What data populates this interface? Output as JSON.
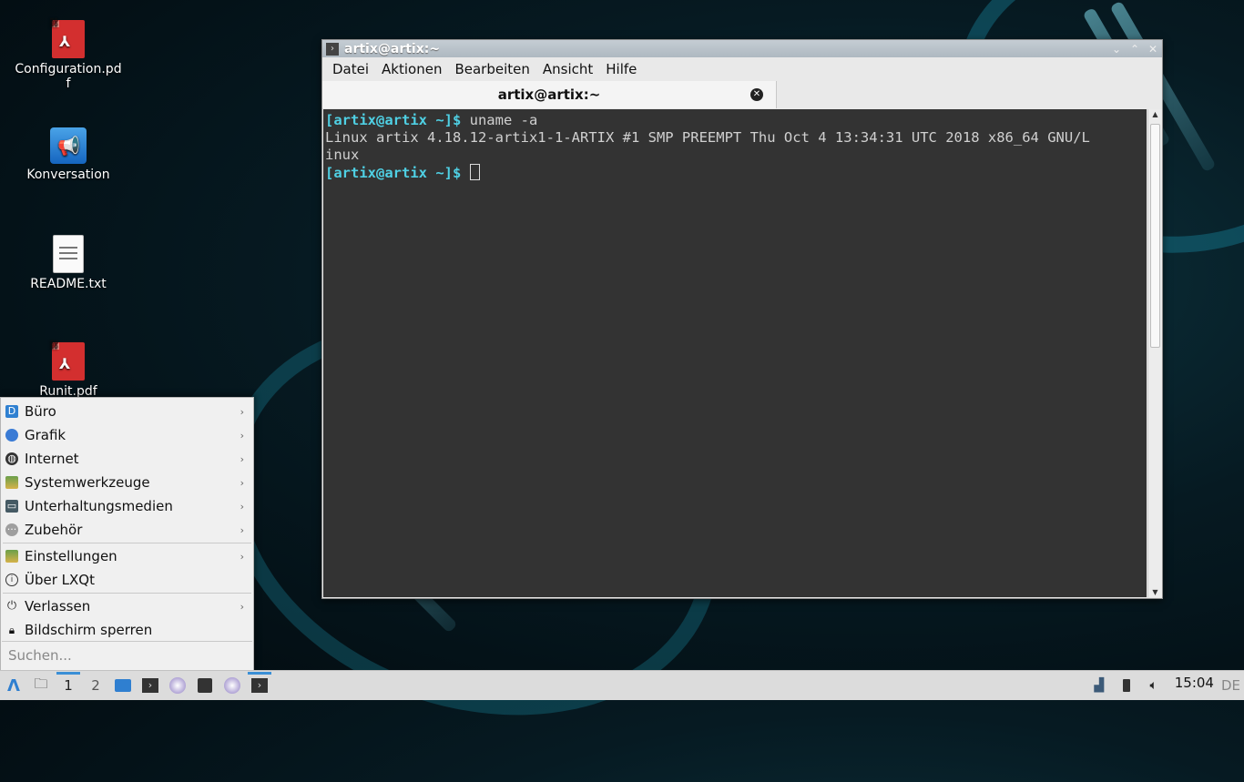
{
  "desktop": {
    "icons": [
      {
        "label": "Configuration.pdf",
        "icon": "pdf-file-icon"
      },
      {
        "label": "Konversation",
        "icon": "konversation-icon"
      },
      {
        "label": "README.txt",
        "icon": "text-file-icon"
      },
      {
        "label": "Runit.pdf",
        "icon": "pdf-file-icon"
      }
    ]
  },
  "window": {
    "title": "artix@artix:~",
    "menu": [
      "Datei",
      "Aktionen",
      "Bearbeiten",
      "Ansicht",
      "Hilfe"
    ],
    "tab_label": "artix@artix:~",
    "terminal": {
      "prompt": "[artix@artix ~]$",
      "command": " uname -a",
      "output_line1": "Linux artix 4.18.12-artix1-1-ARTIX #1 SMP PREEMPT Thu Oct 4 13:34:31 UTC 2018 x86_64 GNU/L",
      "output_line2": "inux"
    }
  },
  "start_menu": {
    "items": [
      {
        "label": "Büro",
        "submenu": true,
        "color": "#2f80d1"
      },
      {
        "label": "Grafik",
        "submenu": true,
        "color": "#3a7bd5"
      },
      {
        "label": "Internet",
        "submenu": true,
        "color": "#333333"
      },
      {
        "label": "Systemwerkzeuge",
        "submenu": true,
        "color": "#6a9f4a"
      },
      {
        "label": "Unterhaltungsmedien",
        "submenu": true,
        "color": "#455a64"
      },
      {
        "label": "Zubehör",
        "submenu": true,
        "color": "#9e9e9e"
      },
      {
        "label": "Einstellungen",
        "submenu": true,
        "color": "#6a9f4a"
      },
      {
        "label": "Über LXQt",
        "submenu": false,
        "color": "#333333"
      },
      {
        "label": "Verlassen",
        "submenu": true,
        "color": "#333333"
      },
      {
        "label": "Bildschirm sperren",
        "submenu": false,
        "color": "#111111"
      }
    ],
    "search_placeholder": "Suchen..."
  },
  "taskbar": {
    "desktop1": "1",
    "desktop2": "2",
    "clock": "15:04",
    "keyboard_layout": "DE"
  }
}
